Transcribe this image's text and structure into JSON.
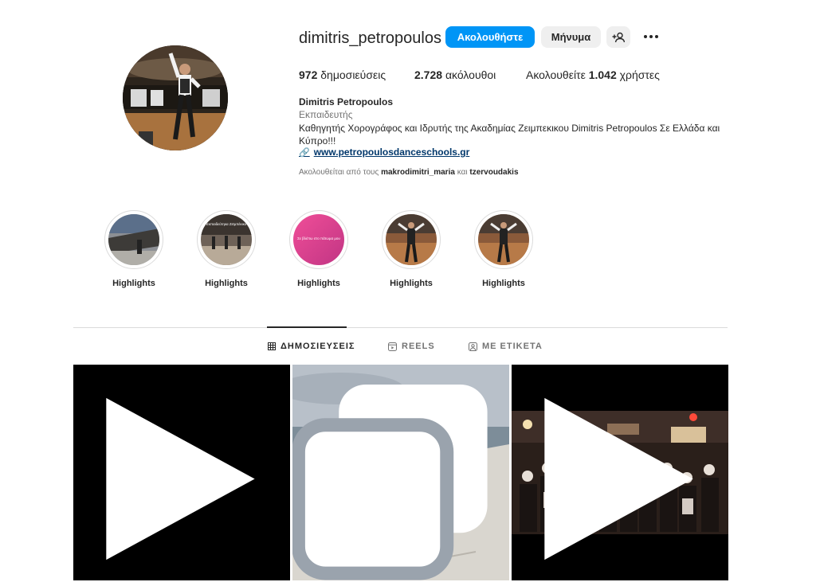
{
  "profile": {
    "username": "dimitris_petropoulos",
    "follow_label": "Ακολουθήστε",
    "message_label": "Μήνυμα",
    "add_user_icon": "add-person-icon",
    "more_icon": "more-options-icon"
  },
  "stats": {
    "posts_count": "972",
    "posts_label": "δημοσιεύσεις",
    "followers_count": "2.728",
    "followers_label": "ακόλουθοι",
    "following_prefix": "Ακολουθείτε",
    "following_count": "1.042",
    "following_suffix": "χρήστες"
  },
  "bio": {
    "full_name": "Dimitris Petropoulos",
    "category": "Εκπαιδευτής",
    "text": "Καθηγητής Χορογράφος και Ιδρυτής της Ακαδημίας Ζειμπεκικου Dimitris Petropoulos Σε Ελλάδα και Κύπρο!!!",
    "link": "www.petropoulosdanceschools.gr",
    "followed_by_prefix": "Ακολουθείται από τους",
    "followed_by_user1": "makrodimitri_maria",
    "followed_by_and": "και",
    "followed_by_user2": "tzervoudakis"
  },
  "highlights": [
    {
      "label": "Highlights"
    },
    {
      "label": "Highlights",
      "cover_text": "Εκπαιδεύτηκα Ζεϊμπέκικο"
    },
    {
      "label": "Highlights",
      "cover_text": "Σε βλέπω στο πάτωμα μου"
    },
    {
      "label": "Highlights"
    },
    {
      "label": "Highlights"
    }
  ],
  "tabs": [
    {
      "label": "ΔΗΜΟΣΙΕΥΣΕΙΣ",
      "icon": "grid-icon",
      "active": true
    },
    {
      "label": "REELS",
      "icon": "reels-icon",
      "active": false
    },
    {
      "label": "ΜΕ ΕΤΙΚΕΤΑ",
      "icon": "tagged-icon",
      "active": false
    }
  ],
  "posts": [
    {
      "type": "reel",
      "badge_icon": "reel-play-icon"
    },
    {
      "type": "carousel",
      "badge_icon": "carousel-icon"
    },
    {
      "type": "reel",
      "badge_icon": "reel-play-icon"
    }
  ],
  "colors": {
    "primary_button": "#0095f6",
    "secondary_button": "#efefef",
    "link": "#00376b",
    "muted_text": "#737373"
  }
}
